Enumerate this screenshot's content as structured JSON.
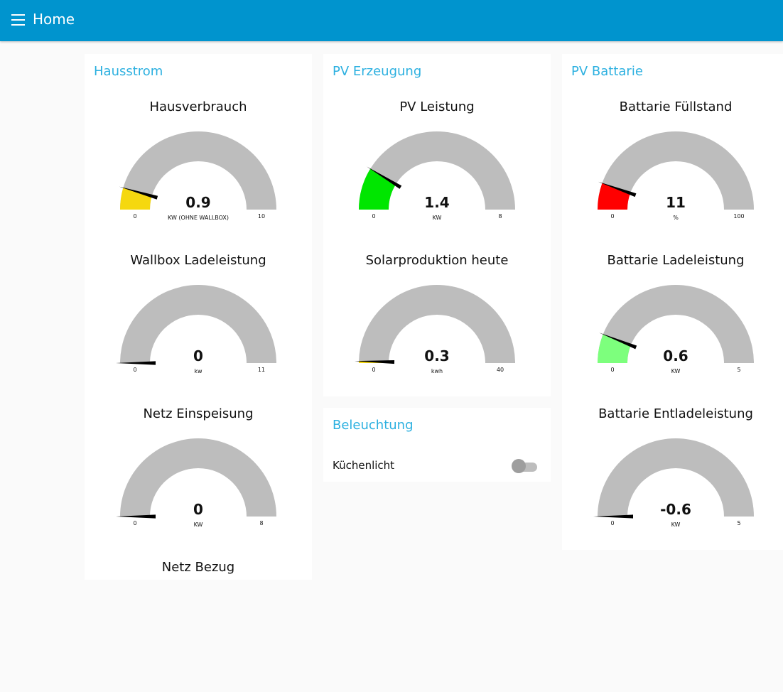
{
  "header": {
    "title": "Home",
    "menu_icon": "menu-icon"
  },
  "colors": {
    "header": "#0094ce",
    "card_title": "#2cb0e0",
    "gauge_track": "#bdbdbd"
  },
  "groups": {
    "hausstrom": {
      "title": "Hausstrom",
      "gauges": [
        {
          "title": "Hausverbrauch",
          "value": 0.9,
          "value_text": "0.9",
          "units": "KW (OHNE WALLBOX)",
          "min": 0,
          "max": 10,
          "min_text": "0",
          "max_text": "10",
          "color": "#f5d80f"
        },
        {
          "title": "Wallbox Ladeleistung",
          "value": 0,
          "value_text": "0",
          "units": "kw",
          "min": 0,
          "max": 11,
          "min_text": "0",
          "max_text": "11",
          "color": "#f5d80f"
        },
        {
          "title": "Netz Einspeisung",
          "value": 0,
          "value_text": "0",
          "units": "KW",
          "min": 0,
          "max": 8,
          "min_text": "0",
          "max_text": "8",
          "color": "#f5d80f"
        },
        {
          "title": "Netz Bezug"
        }
      ]
    },
    "pv_erzeugung": {
      "title": "PV Erzeugung",
      "gauges": [
        {
          "title": "PV Leistung",
          "value": 1.4,
          "value_text": "1.4",
          "units": "KW",
          "min": 0,
          "max": 8,
          "min_text": "0",
          "max_text": "8",
          "color": "#00e600"
        },
        {
          "title": "Solarproduktion heute",
          "value": 0.3,
          "value_text": "0.3",
          "units": "kwh",
          "min": 0,
          "max": 40,
          "min_text": "0",
          "max_text": "40",
          "color": "#f5d80f"
        }
      ]
    },
    "beleuchtung": {
      "title": "Beleuchtung",
      "switch": {
        "label": "Küchenlicht",
        "state": "off"
      }
    },
    "pv_battarie": {
      "title": "PV Battarie",
      "gauges": [
        {
          "title": "Battarie Füllstand",
          "value": 11,
          "value_text": "11",
          "units": "%",
          "min": 0,
          "max": 100,
          "min_text": "0",
          "max_text": "100",
          "color": "#ff0000"
        },
        {
          "title": "Battarie Ladeleistung",
          "value": 0.6,
          "value_text": "0.6",
          "units": "KW",
          "min": 0,
          "max": 5,
          "min_text": "0",
          "max_text": "5",
          "color": "#7dff7d"
        },
        {
          "title": "Battarie Entladeleistung",
          "value": -0.6,
          "value_text": "-0.6",
          "units": "KW",
          "min": 0,
          "max": 5,
          "min_text": "0",
          "max_text": "5",
          "color": "#f5d80f"
        }
      ]
    }
  }
}
